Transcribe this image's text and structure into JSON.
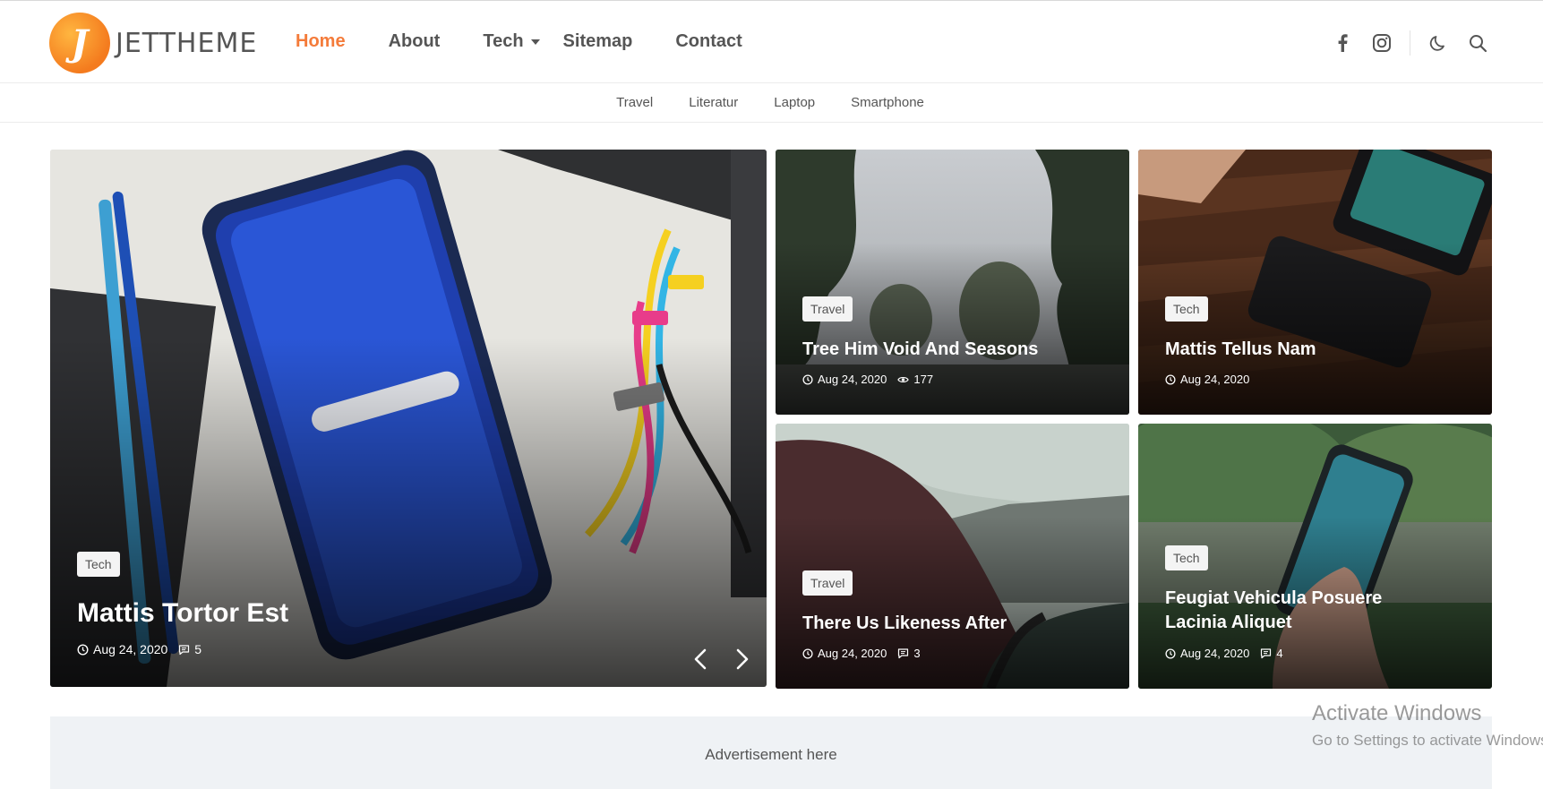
{
  "brand": {
    "logo_letter": "J",
    "name": "JETTHEME"
  },
  "nav": {
    "home": "Home",
    "about": "About",
    "tech": "Tech",
    "sitemap": "Sitemap",
    "contact": "Contact"
  },
  "header_icons": [
    "facebook-icon",
    "instagram-icon",
    "dark-mode-icon",
    "search-icon"
  ],
  "subnav": [
    "Travel",
    "Literatur",
    "Laptop",
    "Smartphone"
  ],
  "featured": {
    "tag": "Tech",
    "title": "Mattis Tortor Est",
    "date": "Aug 24, 2020",
    "comments": "5"
  },
  "cards": [
    {
      "tag": "Travel",
      "title": "Tree Him Void And Seasons",
      "date": "Aug 24, 2020",
      "views": "177"
    },
    {
      "tag": "Tech",
      "title": "Mattis Tellus Nam",
      "date": "Aug 24, 2020"
    },
    {
      "tag": "Travel",
      "title": "There Us Likeness After",
      "date": "Aug 24, 2020",
      "comments": "3"
    },
    {
      "tag": "Tech",
      "title_line1": "Feugiat Vehicula Posuere",
      "title_line2": "Lacinia Aliquet",
      "date": "Aug 24, 2020",
      "comments": "4"
    }
  ],
  "advertisement": "Advertisement here",
  "watermark": {
    "line1": "Activate Windows",
    "line2": "Go to Settings to activate Windows."
  },
  "colors": {
    "accent": "#f47b3a",
    "ad_bg": "#eff2f5"
  }
}
